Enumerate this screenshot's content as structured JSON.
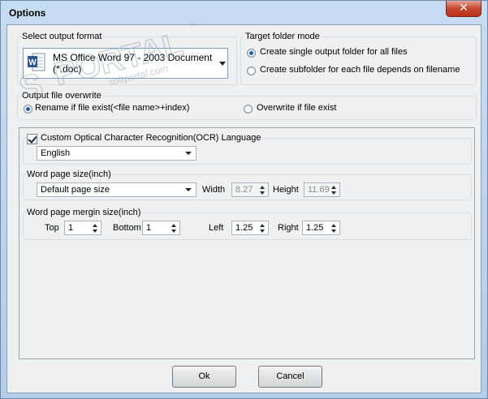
{
  "window": {
    "title": "Options",
    "close_symbol": "✕"
  },
  "watermark": {
    "brand": "PORTAL",
    "trademark": "™",
    "site": "softportal.com"
  },
  "output_format": {
    "label": "Select output format",
    "selected_line1": "MS Office Word 97 - 2003 Document",
    "selected_line2": "(*.doc)",
    "icon": "word-document-icon"
  },
  "target_folder": {
    "label": "Target folder mode",
    "options": [
      {
        "label": "Create single output folder for all files",
        "selected": true
      },
      {
        "label": "Create subfolder for each file depends on filename",
        "selected": false
      }
    ]
  },
  "overwrite": {
    "label": "Output file overwrite",
    "options": [
      {
        "label": "Rename if file exist(<file name>+index)",
        "selected": true
      },
      {
        "label": "Overwrite if file exist",
        "selected": false
      }
    ]
  },
  "ocr": {
    "checkbox_label": "Custom Optical Character Recognition(OCR) Language",
    "checked": true,
    "language": "English"
  },
  "page_size": {
    "label": "Word page size(inch)",
    "preset": "Default page size",
    "width_label": "Width",
    "width_value": "8.27",
    "height_label": "Height",
    "height_value": "11.69"
  },
  "margins": {
    "label": "Word page mergin size(inch)",
    "top_label": "Top",
    "top_value": "1",
    "bottom_label": "Bottom",
    "bottom_value": "1",
    "left_label": "Left",
    "left_value": "1.25",
    "right_label": "Right",
    "right_value": "1.25"
  },
  "buttons": {
    "ok": "Ok",
    "cancel": "Cancel"
  },
  "colors": {
    "accent": "#1d5fae",
    "close": "#c7462f",
    "word_blue": "#2b5797",
    "frame": "#bcd6ee"
  }
}
